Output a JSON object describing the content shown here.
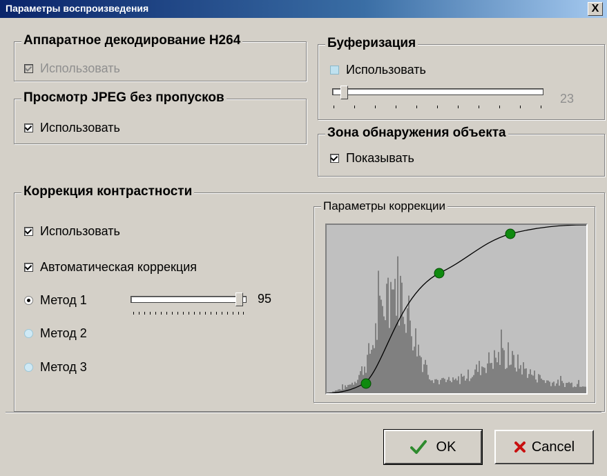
{
  "window": {
    "title": "Параметры воспроизведения",
    "close_symbol": "X"
  },
  "hw_decode": {
    "title": "Аппаратное декодирование H264",
    "checkbox_label": "Использовать",
    "checked": true,
    "disabled": true
  },
  "jpeg": {
    "title": "Просмотр JPEG без пропусков",
    "checkbox_label": "Использовать",
    "checked": true
  },
  "buffer": {
    "title": "Буферизация",
    "checkbox_label": "Использовать",
    "checked": false,
    "slider_value": "23"
  },
  "detection": {
    "title": "Зона обнаружения объекта",
    "checkbox_label": "Показывать",
    "checked": true
  },
  "contrast": {
    "title": "Коррекция контрастности",
    "use_label": "Использовать",
    "auto_label": "Автоматическая коррекция",
    "methods": [
      {
        "label": "Метод 1",
        "selected": true
      },
      {
        "label": "Метод 2",
        "selected": false
      },
      {
        "label": "Метод 3",
        "selected": false
      }
    ],
    "method1_value": "95"
  },
  "correction_params": {
    "title": "Параметры коррекции"
  },
  "buttons": {
    "ok": "OK",
    "cancel": "Cancel"
  },
  "colors": {
    "ok_check": "#2e8b2e",
    "cancel_x": "#c81010",
    "curve_point": "#0f8a0f",
    "histogram_bg": "#c0c0c0",
    "histogram": "#808080"
  }
}
